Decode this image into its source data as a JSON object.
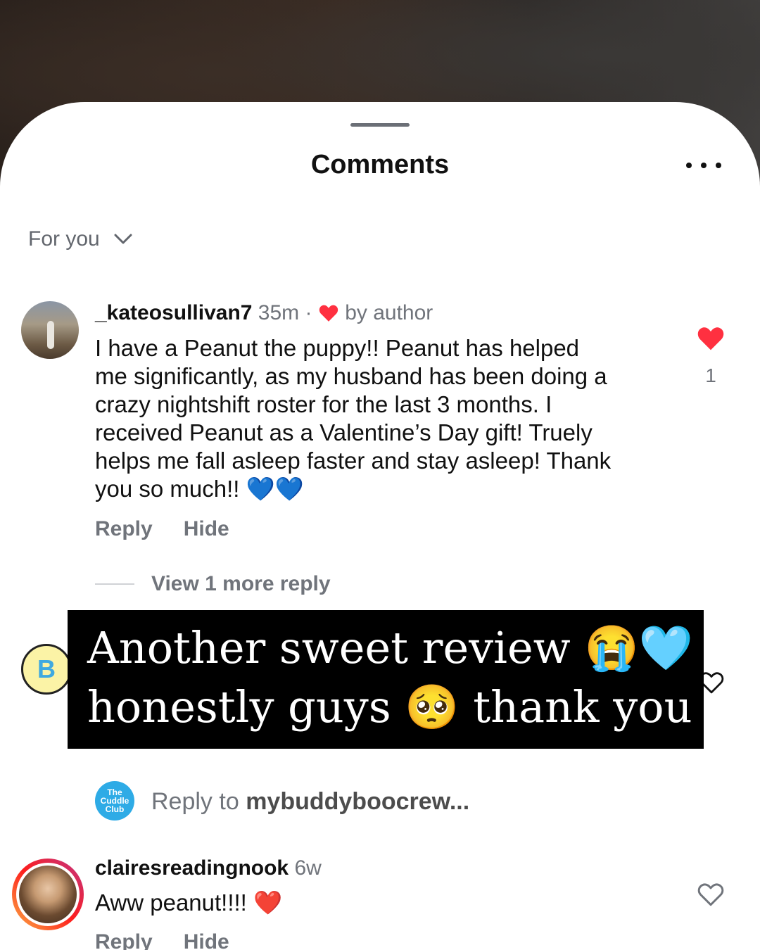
{
  "sheet": {
    "title": "Comments"
  },
  "sort": {
    "label": "For you"
  },
  "comments": [
    {
      "username": "_kateosullivan7",
      "time": "35m",
      "separator": "·",
      "author_like_label": "by author",
      "text_lines": [
        "I have a Peanut the puppy!! Peanut has helped",
        "me significantly, as my husband has been doing a",
        "crazy nightshift roster for the last 3 months. I",
        "received Peanut as a Valentine’s Day gift! Truely",
        "helps me fall asleep faster and stay asleep! Thank",
        "you so much!! 💙💙"
      ],
      "reply_label": "Reply",
      "hide_label": "Hide",
      "likes": "1",
      "view_more": "View 1 more reply"
    },
    {
      "username": "clairesreadingnook",
      "time": "6w",
      "text": "Aww peanut!!!! ❤️",
      "reply_label": "Reply",
      "hide_label": "Hide"
    }
  ],
  "overlay": {
    "line1": "Another sweet review 😭🩵",
    "line2": "honestly guys 🥺 thank you"
  },
  "reply_bar": {
    "prefix": "Reply to ",
    "target": "mybuddyboocrew..."
  },
  "avatars": {
    "second_letter": "B",
    "reply_avatar_text": "The Cuddle Club"
  },
  "colors": {
    "like_red": "#ff3040",
    "muted": "#70747b"
  }
}
